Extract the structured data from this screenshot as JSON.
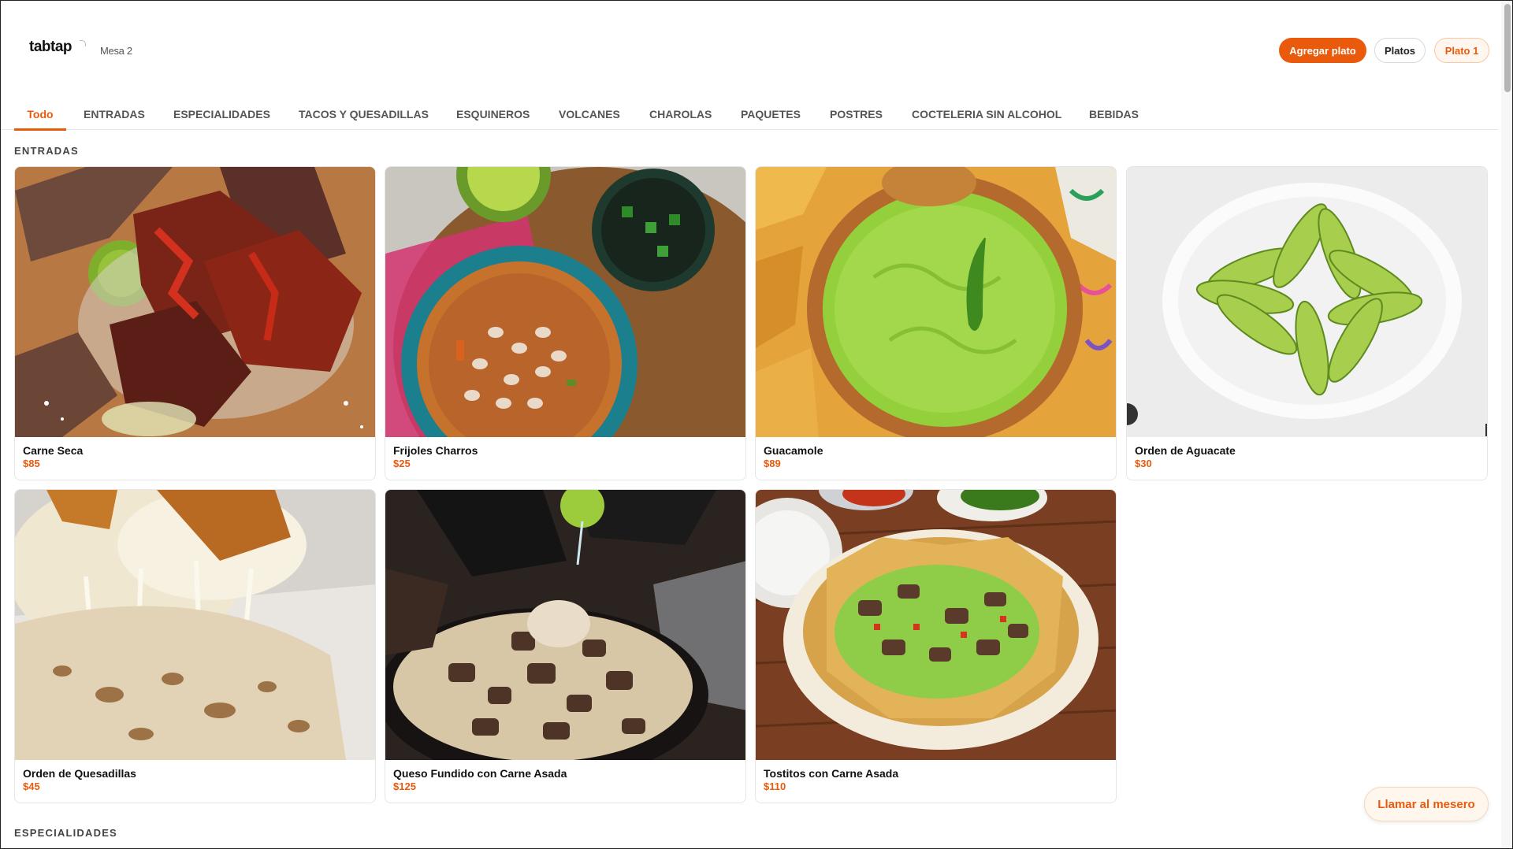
{
  "header": {
    "logo": "tabtap",
    "table": "Mesa 2",
    "add_button": "Agregar plato",
    "plates_button": "Platos",
    "plate1_button": "Plato 1"
  },
  "tabs": [
    {
      "label": "Todo",
      "active": true
    },
    {
      "label": "ENTRADAS"
    },
    {
      "label": "ESPECIALIDADES"
    },
    {
      "label": "TACOS Y QUESADILLAS"
    },
    {
      "label": "ESQUINEROS"
    },
    {
      "label": "VOLCANES"
    },
    {
      "label": "CHAROLAS"
    },
    {
      "label": "PAQUETES"
    },
    {
      "label": "POSTRES"
    },
    {
      "label": "COCTELERIA SIN ALCOHOL"
    },
    {
      "label": "BEBIDAS"
    }
  ],
  "sections": [
    {
      "title": "ENTRADAS",
      "items": [
        {
          "name": "Carne Seca",
          "price": "$85",
          "image": "dried-beef-photo"
        },
        {
          "name": "Frijoles Charros",
          "price": "$25",
          "image": "bean-soup-photo"
        },
        {
          "name": "Guacamole",
          "price": "$89",
          "image": "guacamole-photo"
        },
        {
          "name": "Orden de Aguacate",
          "price": "$30",
          "image": "sliced-avocado-photo"
        },
        {
          "name": "Orden de Quesadillas",
          "price": "$45",
          "image": "quesadilla-photo"
        },
        {
          "name": "Queso Fundido con Carne Asada",
          "price": "$125",
          "image": "queso-fundido-photo"
        },
        {
          "name": "Tostitos con Carne Asada",
          "price": "$110",
          "image": "nachos-photo"
        }
      ]
    },
    {
      "title": "ESPECIALIDADES",
      "items": []
    }
  ],
  "call_waiter": "Llamar al mesero",
  "colors": {
    "accent": "#ea5a0c",
    "accent_soft": "#fff7ef",
    "text": "#111111",
    "muted": "#555555"
  }
}
